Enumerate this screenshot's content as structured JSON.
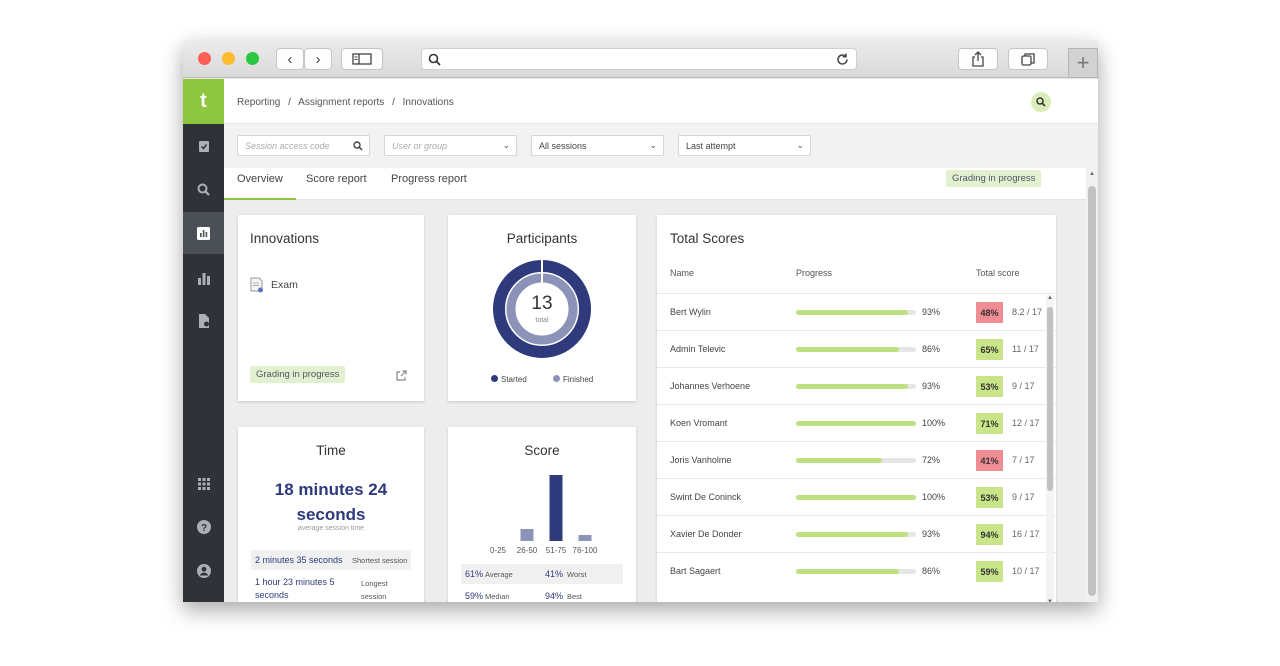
{
  "browser": {
    "new_tab": "+"
  },
  "app": {
    "logo": "t"
  },
  "breadcrumb": [
    "Reporting",
    "Assignment reports",
    "Innovations"
  ],
  "filters": {
    "session_code_placeholder": "Session access code",
    "user_placeholder": "User or group",
    "sessions": "All sessions",
    "attempt": "Last attempt"
  },
  "tabs": [
    "Overview",
    "Score report",
    "Progress report"
  ],
  "status_chip": "Grading in progress",
  "innovations": {
    "title": "Innovations",
    "item": "Exam",
    "chip": "Grading in progress"
  },
  "participants": {
    "title": "Participants",
    "total": "13",
    "total_label": "total",
    "legend_started": "Started",
    "legend_finished": "Finished",
    "started_color": "#2e3a7c",
    "finished_color": "#8b94b8"
  },
  "time": {
    "title": "Time",
    "value": "18 minutes 24 seconds",
    "caption": "average session time",
    "shortest_value": "2 minutes 35 seconds",
    "shortest_label": "Shortest session",
    "longest_value": "1 hour 23 minutes 5 seconds",
    "longest_label": "Longest session"
  },
  "score": {
    "title": "Score",
    "chart_data": {
      "type": "bar",
      "categories": [
        "0-25",
        "26-50",
        "51-75",
        "76-100"
      ],
      "values": [
        0,
        2,
        11,
        1
      ],
      "colors": [
        "#8b94b8",
        "#8b94b8",
        "#2e3a7c",
        "#8b94b8"
      ]
    },
    "stats": [
      {
        "v": "61%",
        "l": "Average"
      },
      {
        "v": "41%",
        "l": "Worst"
      },
      {
        "v": "59%",
        "l": "Median"
      },
      {
        "v": "94%",
        "l": "Best"
      }
    ]
  },
  "total_scores": {
    "title": "Total Scores",
    "col_name": "Name",
    "col_progress": "Progress",
    "col_total": "Total score",
    "rows": [
      {
        "name": "Bert Wylin",
        "progress": 93,
        "progress_text": "93%",
        "score": "48%",
        "fraction": "8.2 / 17",
        "status": "fail"
      },
      {
        "name": "Admin Televic",
        "progress": 86,
        "progress_text": "86%",
        "score": "65%",
        "fraction": "11 / 17",
        "status": "pass"
      },
      {
        "name": "Johannes Verhoene",
        "progress": 93,
        "progress_text": "93%",
        "score": "53%",
        "fraction": "9 / 17",
        "status": "pass"
      },
      {
        "name": "Koen Vromant",
        "progress": 100,
        "progress_text": "100%",
        "score": "71%",
        "fraction": "12 / 17",
        "status": "pass"
      },
      {
        "name": "Joris Vanholme",
        "progress": 72,
        "progress_text": "72%",
        "score": "41%",
        "fraction": "7 / 17",
        "status": "fail"
      },
      {
        "name": "Swint De Coninck",
        "progress": 100,
        "progress_text": "100%",
        "score": "53%",
        "fraction": "9 / 17",
        "status": "pass"
      },
      {
        "name": "Xavier De Donder",
        "progress": 93,
        "progress_text": "93%",
        "score": "94%",
        "fraction": "16 / 17",
        "status": "pass"
      },
      {
        "name": "Bart Sagaert",
        "progress": 86,
        "progress_text": "86%",
        "score": "59%",
        "fraction": "10 / 17",
        "status": "pass"
      }
    ],
    "pass_color": "#c8e58a",
    "fail_color": "#f08c93"
  }
}
